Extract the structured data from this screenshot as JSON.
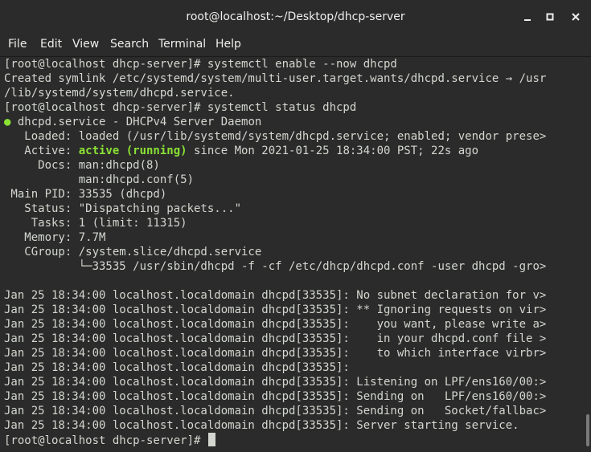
{
  "window": {
    "title": "root@localhost:~/Desktop/dhcp-server",
    "minimize_glyph": "minimize-icon",
    "maximize_glyph": "maximize-icon",
    "close_glyph": "close-icon"
  },
  "menu": [
    "File",
    "Edit",
    "View",
    "Search",
    "Terminal",
    "Help"
  ],
  "colors": {
    "background": "#2b2b2b",
    "text": "#d3d7cf",
    "status_green": "#8ae234"
  },
  "terminal": {
    "lines": [
      [
        {
          "t": "[root@localhost dhcp-server]# systemctl enable --now dhcpd"
        }
      ],
      [
        {
          "t": "Created symlink /etc/systemd/system/multi-user.target.wants/dhcpd.service → /usr"
        }
      ],
      [
        {
          "t": "/lib/systemd/system/dhcpd.service."
        }
      ],
      [
        {
          "t": "[root@localhost dhcp-server]# systemctl status dhcpd"
        }
      ],
      [
        {
          "t": "●",
          "c": "dot"
        },
        {
          "t": " dhcpd.service - DHCPv4 Server Daemon"
        }
      ],
      [
        {
          "t": "   Loaded: loaded (/usr/lib/systemd/system/dhcpd.service; enabled; vendor prese>"
        }
      ],
      [
        {
          "t": "   Active: "
        },
        {
          "t": "active (running)",
          "c": "green"
        },
        {
          "t": " since Mon 2021-01-25 18:34:00 PST; 22s ago"
        }
      ],
      [
        {
          "t": "     Docs: man:dhcpd(8)"
        }
      ],
      [
        {
          "t": "           man:dhcpd.conf(5)"
        }
      ],
      [
        {
          "t": " Main PID: 33535 (dhcpd)"
        }
      ],
      [
        {
          "t": "   Status: \"Dispatching packets...\""
        }
      ],
      [
        {
          "t": "    Tasks: 1 (limit: 11315)"
        }
      ],
      [
        {
          "t": "   Memory: 7.7M"
        }
      ],
      [
        {
          "t": "   CGroup: /system.slice/dhcpd.service"
        }
      ],
      [
        {
          "t": "           └─33535 /usr/sbin/dhcpd -f -cf /etc/dhcp/dhcpd.conf -user dhcpd -gro>"
        }
      ],
      [
        {
          "t": ""
        }
      ],
      [
        {
          "t": "Jan 25 18:34:00 localhost.localdomain dhcpd[33535]: No subnet declaration for v>"
        }
      ],
      [
        {
          "t": "Jan 25 18:34:00 localhost.localdomain dhcpd[33535]: ** Ignoring requests on vir>"
        }
      ],
      [
        {
          "t": "Jan 25 18:34:00 localhost.localdomain dhcpd[33535]:    you want, please write a>"
        }
      ],
      [
        {
          "t": "Jan 25 18:34:00 localhost.localdomain dhcpd[33535]:    in your dhcpd.conf file >"
        }
      ],
      [
        {
          "t": "Jan 25 18:34:00 localhost.localdomain dhcpd[33535]:    to which interface virbr>"
        }
      ],
      [
        {
          "t": "Jan 25 18:34:00 localhost.localdomain dhcpd[33535]:"
        }
      ],
      [
        {
          "t": "Jan 25 18:34:00 localhost.localdomain dhcpd[33535]: Listening on LPF/ens160/00:>"
        }
      ],
      [
        {
          "t": "Jan 25 18:34:00 localhost.localdomain dhcpd[33535]: Sending on   LPF/ens160/00:>"
        }
      ],
      [
        {
          "t": "Jan 25 18:34:00 localhost.localdomain dhcpd[33535]: Sending on   Socket/fallbac>"
        }
      ],
      [
        {
          "t": "Jan 25 18:34:00 localhost.localdomain dhcpd[33535]: Server starting service."
        }
      ]
    ],
    "prompt": "[root@localhost dhcp-server]# "
  }
}
